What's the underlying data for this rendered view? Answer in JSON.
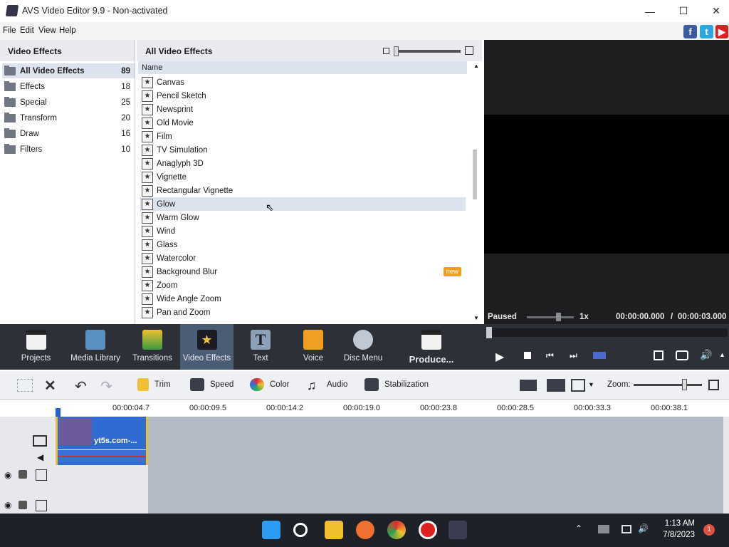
{
  "window": {
    "title": "AVS Video Editor 9.9 - Non-activated"
  },
  "menu": [
    "File",
    "Edit",
    "View",
    "Help"
  ],
  "left_panel": {
    "title": "Video Effects",
    "categories": [
      {
        "label": "All Video Effects",
        "count": "89"
      },
      {
        "label": "Effects",
        "count": "18"
      },
      {
        "label": "Special",
        "count": "25"
      },
      {
        "label": "Transform",
        "count": "20"
      },
      {
        "label": "Draw",
        "count": "16"
      },
      {
        "label": "Filters",
        "count": "10"
      }
    ]
  },
  "effects_panel": {
    "title": "All Video Effects",
    "column_name": "Name",
    "new_badge": "new",
    "items": [
      "Canvas",
      "Pencil Sketch",
      "Newsprint",
      "Old Movie",
      "Film",
      "TV Simulation",
      "Anaglyph 3D",
      "Vignette",
      "Rectangular Vignette",
      "Glow",
      "Warm Glow",
      "Wind",
      "Glass",
      "Watercolor",
      "Background Blur",
      "Zoom",
      "Wide Angle Zoom",
      "Pan and Zoom"
    ],
    "selected": "Glow"
  },
  "player": {
    "status": "Paused",
    "speed": "1x",
    "time_current": "00:00:00.000",
    "time_separator": "/",
    "time_total": "00:00:03.000"
  },
  "main_toolbar": {
    "projects": "Projects",
    "media_library": "Media Library",
    "transitions": "Transitions",
    "video_effects": "Video Effects",
    "text": "Text",
    "voice": "Voice",
    "disc_menu": "Disc Menu",
    "produce": "Produce..."
  },
  "edit_toolbar": {
    "trim": "Trim",
    "speed": "Speed",
    "color": "Color",
    "audio": "Audio",
    "stabilization": "Stabilization",
    "zoom_label": "Zoom:"
  },
  "timeline": {
    "ticks": [
      "00:00:04.7",
      "00:00:09.5",
      "00:00:14.2",
      "00:00:19.0",
      "00:00:23.8",
      "00:00:28.5",
      "00:00:33.3",
      "00:00:38.1"
    ],
    "clip_label": "yt5s.com-..."
  },
  "taskbar": {
    "time": "1:13 AM",
    "date": "7/8/2023",
    "notification_count": "1"
  },
  "colors": {
    "accent": "#4b5d75",
    "timeline": "#b3bac6",
    "new_badge": "#f0a020"
  }
}
